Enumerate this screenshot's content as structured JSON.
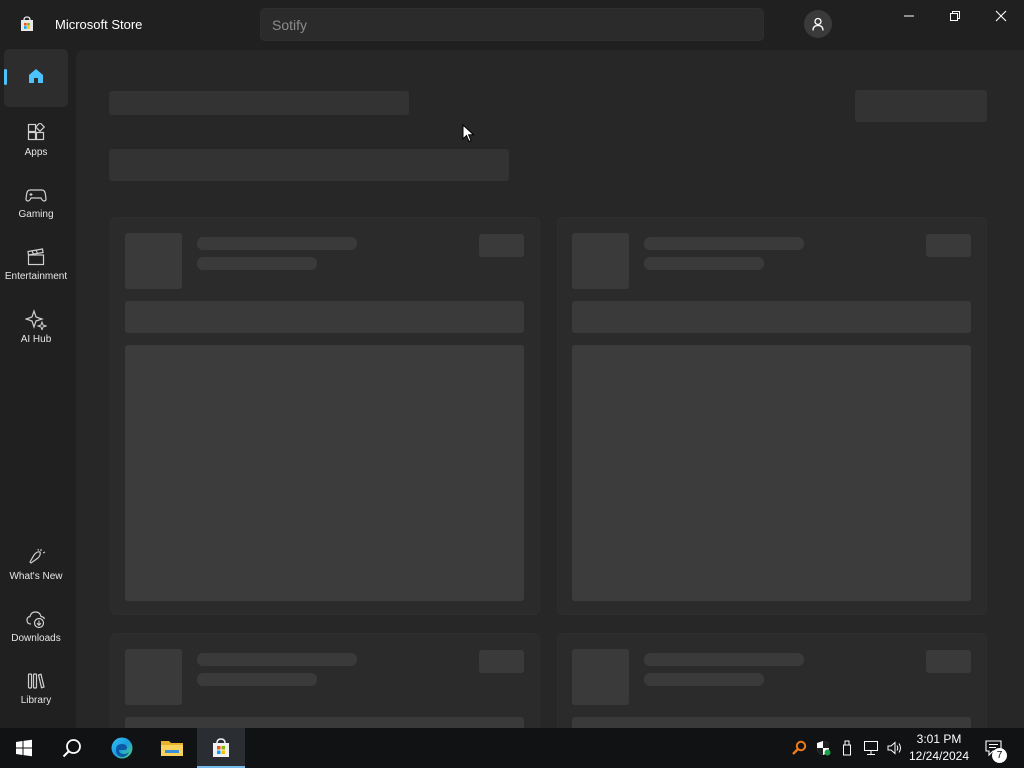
{
  "window": {
    "title": "Microsoft Store",
    "search_placeholder": "Sotify"
  },
  "sidebar": {
    "items": [
      {
        "label": "",
        "icon": "home-icon",
        "active": true
      },
      {
        "label": "Apps",
        "icon": "apps-icon"
      },
      {
        "label": "Gaming",
        "icon": "gamepad-icon"
      },
      {
        "label": "Entertainment",
        "icon": "clapperboard-icon"
      },
      {
        "label": "AI Hub",
        "icon": "sparkle-icon"
      }
    ],
    "bottom_items": [
      {
        "label": "What's New",
        "icon": "megaphone-icon"
      },
      {
        "label": "Downloads",
        "icon": "cloud-download-icon"
      },
      {
        "label": "Library",
        "icon": "library-icon"
      }
    ]
  },
  "colors": {
    "accent": "#4cc2ff",
    "background": "#202020",
    "content": "#272727",
    "placeholder": "#333333",
    "taskbar": "#101214"
  },
  "taskbar": {
    "apps": [
      "start-icon",
      "search-icon",
      "edge-icon",
      "file-explorer-icon",
      "store-icon"
    ],
    "tray_icons": [
      "search-tray-icon",
      "security-icon",
      "usb-icon",
      "network-icon",
      "volume-icon"
    ],
    "time": "3:01 PM",
    "date": "12/24/2024",
    "notification_count": "7"
  }
}
